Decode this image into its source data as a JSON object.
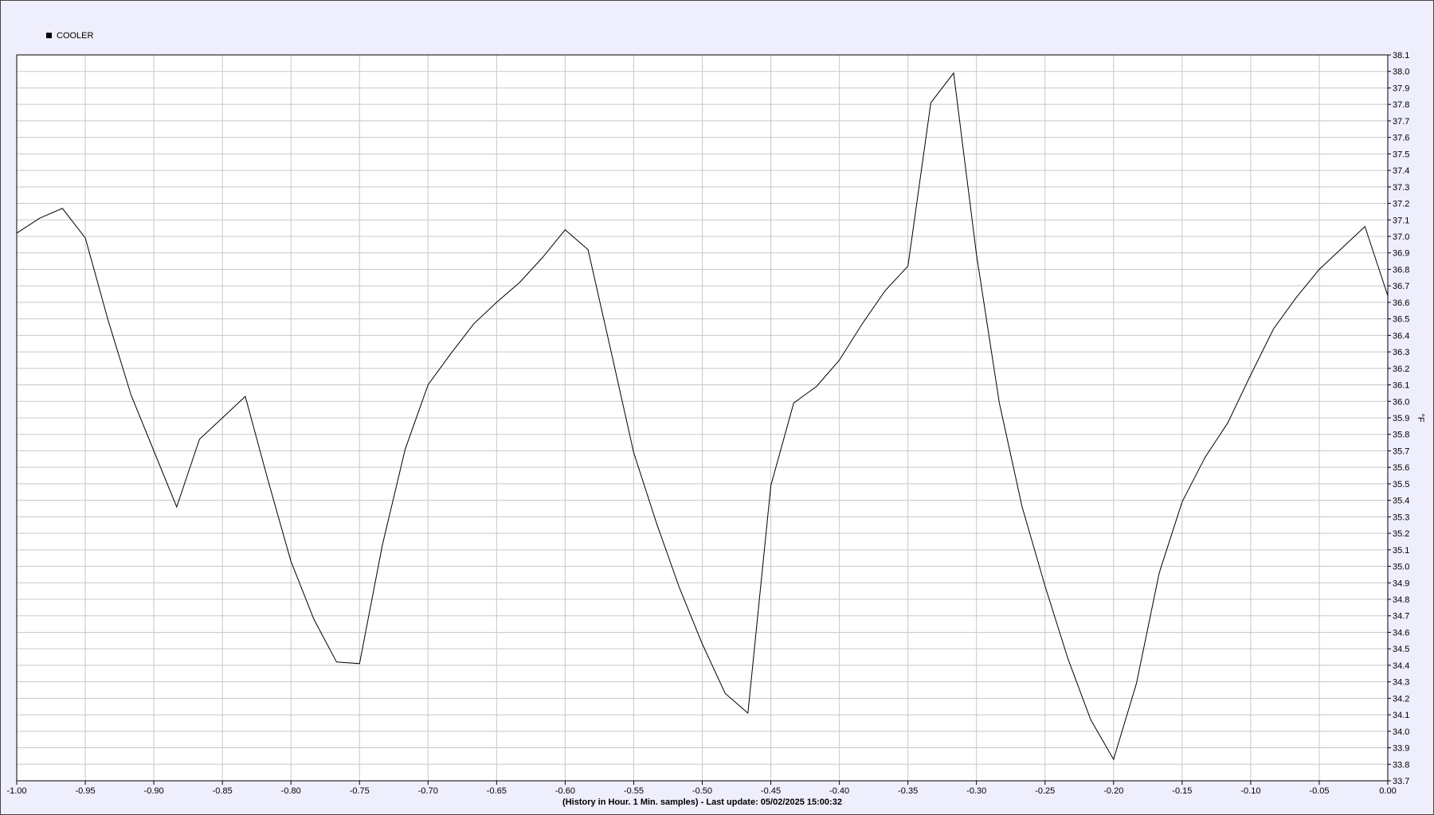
{
  "chart_data": {
    "type": "line",
    "title": "",
    "xlabel": "(History in Hour. 1 Min. samples) - Last update: 05/02/2025 15:00:32",
    "ylabel": "°F",
    "xlim": [
      -1.0,
      0.0
    ],
    "ylim": [
      33.7,
      38.1
    ],
    "grid": true,
    "legend": "top-left",
    "line_color": "#000000",
    "background_color": "#eeeefc",
    "plot_background_color": "#ffffff",
    "x_ticks": [
      "-1.00",
      "-0.95",
      "-0.90",
      "-0.85",
      "-0.80",
      "-0.75",
      "-0.70",
      "-0.65",
      "-0.60",
      "-0.55",
      "-0.50",
      "-0.45",
      "-0.40",
      "-0.35",
      "-0.30",
      "-0.25",
      "-0.20",
      "-0.15",
      "-0.10",
      "-0.05",
      "0.00"
    ],
    "y_ticks": [
      "33.7",
      "33.8",
      "33.9",
      "34.0",
      "34.1",
      "34.2",
      "34.3",
      "34.4",
      "34.5",
      "34.6",
      "34.7",
      "34.8",
      "34.9",
      "35.0",
      "35.1",
      "35.2",
      "35.3",
      "35.4",
      "35.5",
      "35.6",
      "35.7",
      "35.8",
      "35.9",
      "36.0",
      "36.1",
      "36.2",
      "36.3",
      "36.4",
      "36.5",
      "36.6",
      "36.7",
      "36.8",
      "36.9",
      "37.0",
      "37.1",
      "37.2",
      "37.3",
      "37.4",
      "37.5",
      "37.6",
      "37.7",
      "37.8",
      "37.9",
      "38.0",
      "38.1"
    ],
    "series": [
      {
        "name": "COOLER",
        "x": [
          -1.0,
          -0.9833,
          -0.9667,
          -0.95,
          -0.9333,
          -0.9167,
          -0.9,
          -0.8833,
          -0.8667,
          -0.85,
          -0.8333,
          -0.8167,
          -0.8,
          -0.7833,
          -0.7667,
          -0.75,
          -0.7333,
          -0.7167,
          -0.7,
          -0.6833,
          -0.6667,
          -0.65,
          -0.6333,
          -0.6167,
          -0.6,
          -0.5833,
          -0.5667,
          -0.55,
          -0.5333,
          -0.5167,
          -0.5,
          -0.4833,
          -0.4667,
          -0.45,
          -0.4333,
          -0.4167,
          -0.4,
          -0.3833,
          -0.3667,
          -0.35,
          -0.3333,
          -0.3167,
          -0.3,
          -0.2833,
          -0.2667,
          -0.25,
          -0.2333,
          -0.2167,
          -0.2,
          -0.1833,
          -0.1667,
          -0.15,
          -0.1333,
          -0.1167,
          -0.1,
          -0.0833,
          -0.0667,
          -0.05,
          -0.0333,
          -0.0167,
          0.0
        ],
        "y": [
          37.02,
          37.11,
          37.17,
          36.99,
          36.49,
          36.04,
          35.7,
          35.36,
          35.77,
          35.9,
          36.03,
          35.52,
          35.03,
          34.68,
          34.42,
          34.41,
          35.13,
          35.71,
          36.1,
          36.29,
          36.47,
          36.6,
          36.72,
          36.87,
          37.04,
          36.92,
          36.31,
          35.69,
          35.26,
          34.87,
          34.53,
          34.23,
          34.11,
          35.49,
          35.99,
          36.09,
          36.25,
          36.47,
          36.67,
          36.82,
          37.81,
          37.99,
          36.89,
          35.99,
          35.36,
          34.88,
          34.44,
          34.07,
          33.83,
          34.29,
          34.96,
          35.39,
          35.66,
          35.87,
          36.16,
          36.44,
          36.63,
          36.8,
          36.93,
          37.06,
          36.64
        ]
      }
    ]
  }
}
